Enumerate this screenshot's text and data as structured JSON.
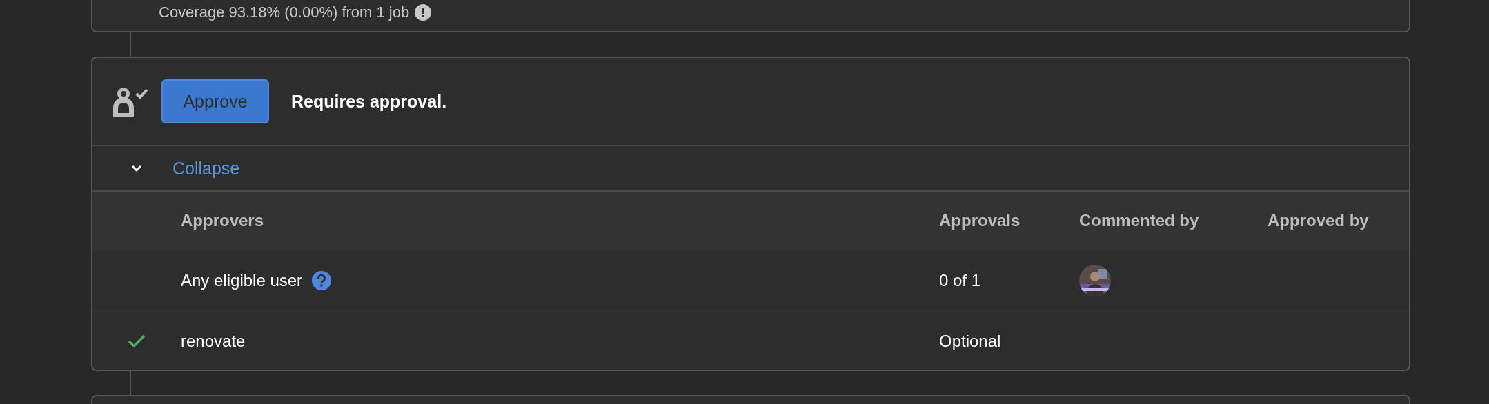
{
  "previous_card": {
    "coverage_text": "Coverage 93.18% (0.00%) from 1 job"
  },
  "approval": {
    "button": "Approve",
    "status": "Requires approval.",
    "toggle": {
      "label": "Collapse",
      "expanded": true
    },
    "table": {
      "columns": [
        "Approvers",
        "Approvals",
        "Commented by",
        "Approved by"
      ],
      "rows": [
        {
          "approver": "Any eligible user",
          "help": true,
          "approved": false,
          "approvals": "0 of 1"
        },
        {
          "approver": "renovate",
          "help": false,
          "approved": true,
          "approvals": "Optional"
        }
      ]
    }
  }
}
